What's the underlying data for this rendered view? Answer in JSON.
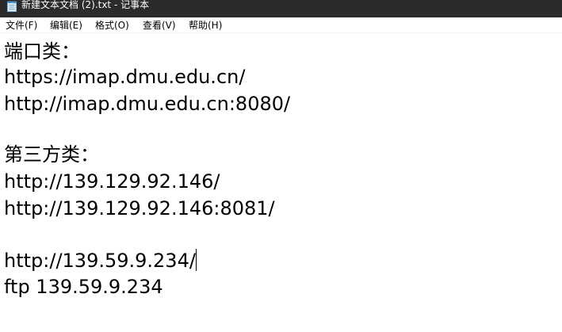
{
  "window": {
    "title": "新建文本文档 (2).txt - 记事本",
    "icon": "notepad-icon"
  },
  "menubar": {
    "items": [
      {
        "label": "文件(F)"
      },
      {
        "label": "编辑(E)"
      },
      {
        "label": "格式(O)"
      },
      {
        "label": "查看(V)"
      },
      {
        "label": "帮助(H)"
      }
    ]
  },
  "editor": {
    "lines": [
      "端口类：",
      "https://imap.dmu.edu.cn/",
      "http://imap.dmu.edu.cn:8080/",
      "",
      "第三方类：",
      "http://139.129.92.146/",
      "http://139.129.92.146:8081/",
      "",
      "http://139.59.9.234/",
      "ftp 139.59.9.234"
    ]
  }
}
